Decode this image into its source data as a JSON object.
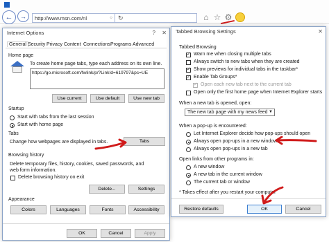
{
  "browser": {
    "url": "http://www.msn.com/nl",
    "icons": [
      "back-icon",
      "forward-icon",
      "search-icon",
      "refresh-icon",
      "home-icon",
      "favorites-star-icon",
      "gear-icon",
      "smiley-icon"
    ]
  },
  "internet_options": {
    "title": "Internet Options",
    "tabs": [
      "General",
      "Security",
      "Privacy",
      "Content",
      "Connections",
      "Programs",
      "Advanced"
    ],
    "home_page": {
      "heading": "Home page",
      "description": "To create home page tabs, type each address on its own line.",
      "url_value": "https://go.microsoft.com/fwlink/p/?LinkId=619797&pc=UE",
      "use_current": "Use current",
      "use_default": "Use default",
      "use_new_tab": "Use new tab"
    },
    "startup": {
      "heading": "Startup",
      "option_last_session": "Start with tabs from the last session",
      "option_home_page": "Start with home page"
    },
    "tabs_section": {
      "heading": "Tabs",
      "description": "Change how webpages are displayed in tabs.",
      "button": "Tabs"
    },
    "browsing_history": {
      "heading": "Browsing history",
      "description": "Delete temporary files, history, cookies, saved passwords, and web form information.",
      "delete_on_exit": "Delete browsing history on exit",
      "delete_button": "Delete...",
      "settings_button": "Settings"
    },
    "appearance": {
      "heading": "Appearance",
      "colors": "Colors",
      "languages": "Languages",
      "fonts": "Fonts",
      "accessibility": "Accessibility"
    },
    "footer": {
      "ok": "OK",
      "cancel": "Cancel",
      "apply": "Apply"
    }
  },
  "tabbed_browsing": {
    "title": "Tabbed Browsing Settings",
    "section_heading": "Tabbed Browsing",
    "options": [
      {
        "label": "Warn me when closing multiple tabs",
        "checked": true
      },
      {
        "label": "Always switch to new tabs when they are created",
        "checked": false
      },
      {
        "label": "Show previews for individual tabs in the taskbar*",
        "checked": true
      },
      {
        "label": "Enable Tab Groups*",
        "checked": true
      },
      {
        "label": "Open each new tab next to the current tab",
        "checked": true,
        "disabled": true
      },
      {
        "label": "Open only the first home page when Internet Explorer starts",
        "checked": false
      }
    ],
    "new_tab_heading": "When a new tab is opened, open:",
    "new_tab_select": "The new tab page with my news feed",
    "popup_heading": "When a pop-up is encountered:",
    "popup_options": [
      {
        "label": "Let Internet Explorer decide how pop-ups should open",
        "selected": false
      },
      {
        "label": "Always open pop-ups in a new window",
        "selected": true
      },
      {
        "label": "Always open pop-ups in a new tab",
        "selected": false
      }
    ],
    "links_heading": "Open links from other programs in:",
    "links_options": [
      {
        "label": "A new window",
        "selected": false
      },
      {
        "label": "A new tab in the current window",
        "selected": true
      },
      {
        "label": "The current tab or window",
        "selected": false
      }
    ],
    "note": "* Takes effect after you restart your computer",
    "restore_defaults": "Restore defaults",
    "ok": "OK",
    "cancel": "Cancel"
  },
  "annotation_color": "#d01b1b"
}
